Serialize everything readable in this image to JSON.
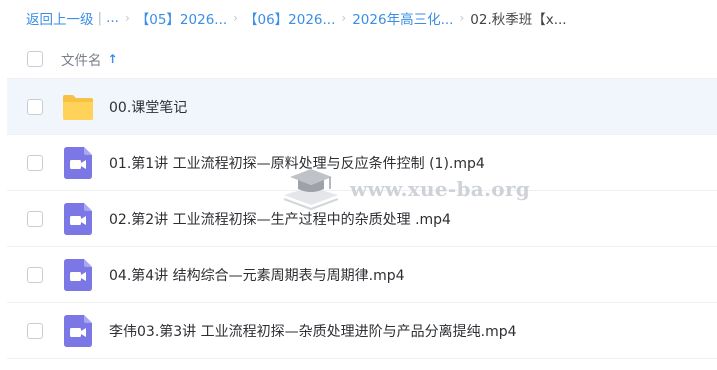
{
  "breadcrumb": {
    "back_label": "返回上一级",
    "ellipsis": "...",
    "crumbs": [
      "【05】2026...",
      "【06】2026...",
      "2026年高三化..."
    ],
    "current": "02.秋季班【x..."
  },
  "header": {
    "name_column": "文件名",
    "sort_icon": "arrow-up-icon"
  },
  "files": [
    {
      "name": "00.课堂笔记",
      "type": "folder"
    },
    {
      "name": "01.第1讲 工业流程初探—原料处理与反应条件控制 (1).mp4",
      "type": "video"
    },
    {
      "name": "02.第2讲 工业流程初探—生产过程中的杂质处理 .mp4",
      "type": "video"
    },
    {
      "name": "04.第4讲 结构综合—元素周期表与周期律.mp4",
      "type": "video"
    },
    {
      "name": "李伟03.第3讲 工业流程初探—杂质处理进阶与产品分离提纯.mp4",
      "type": "video"
    }
  ],
  "watermark": {
    "text": "www.xue-ba.org"
  },
  "colors": {
    "accent": "#3a8ee6",
    "folder": "#ffd25a",
    "video": "#7b78e6",
    "row_highlight": "#f1f6fd"
  }
}
